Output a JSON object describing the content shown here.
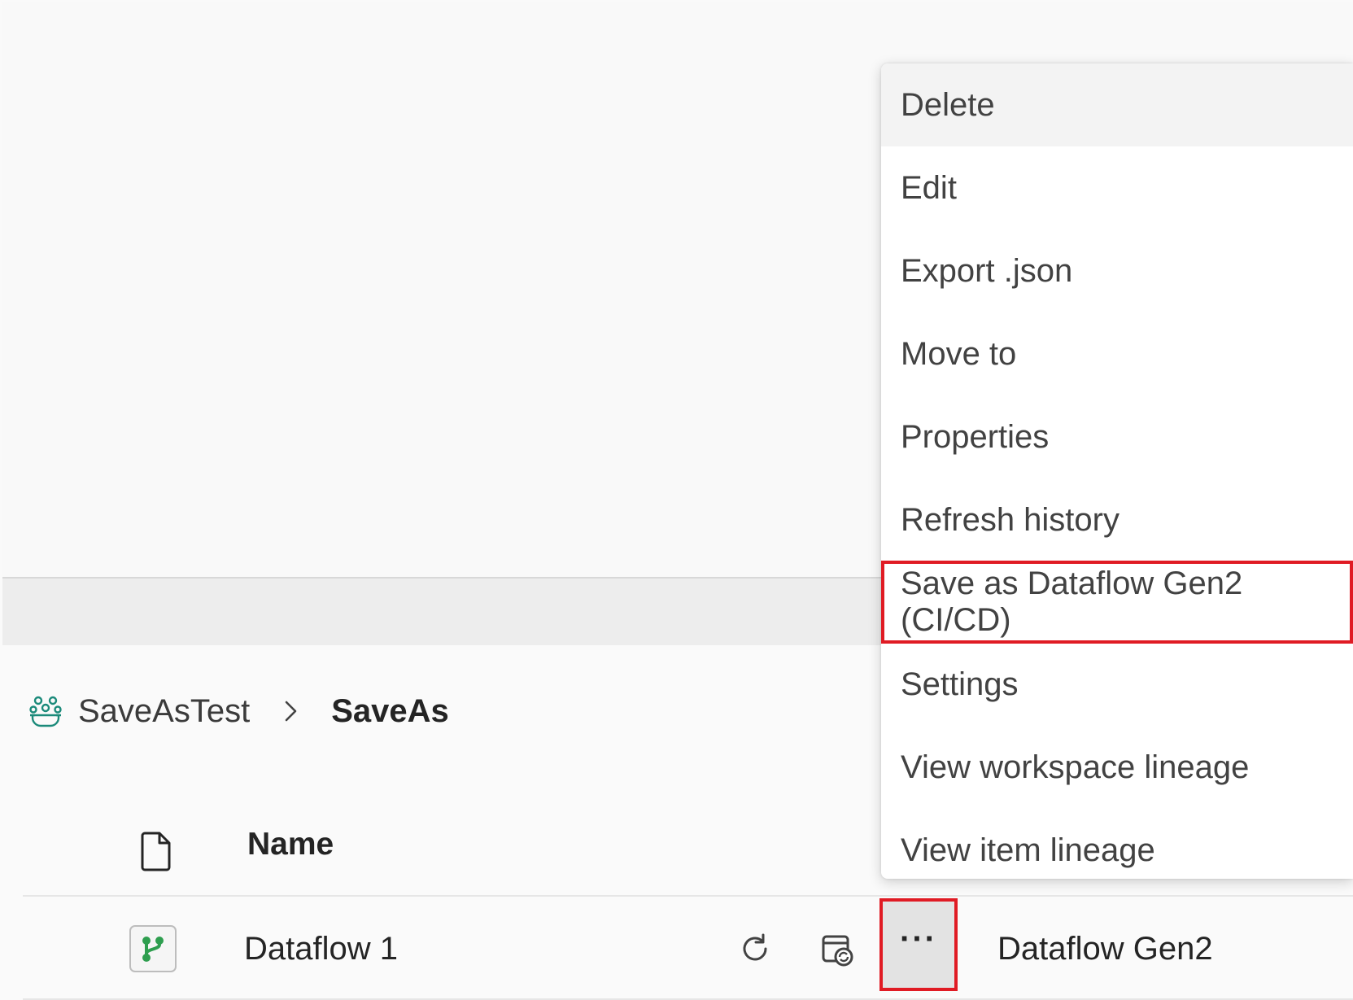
{
  "breadcrumb": {
    "workspace": "SaveAsTest",
    "current": "SaveAs"
  },
  "table": {
    "header_name": "Name",
    "rows": [
      {
        "name": "Dataflow 1",
        "type": "Dataflow Gen2",
        "more_label": "···"
      }
    ]
  },
  "context_menu": {
    "items": [
      {
        "label": "Delete"
      },
      {
        "label": "Edit"
      },
      {
        "label": "Export .json"
      },
      {
        "label": "Move to"
      },
      {
        "label": "Properties"
      },
      {
        "label": "Refresh history"
      },
      {
        "label": "Save as Dataflow Gen2 (CI/CD)"
      },
      {
        "label": "Settings"
      },
      {
        "label": "View workspace lineage"
      },
      {
        "label": "View item lineage"
      }
    ]
  },
  "colors": {
    "highlight_border": "#e01b24",
    "workspace_icon": "#1b8a7a",
    "dataflow_icon": "#2e9e4f"
  },
  "icons": {
    "workspace": "workspace-people-icon",
    "separator": "chevron-right-icon",
    "file": "document-icon",
    "dataflow": "dataflow-branch-icon",
    "refresh": "refresh-icon",
    "schedule": "schedule-refresh-icon"
  }
}
